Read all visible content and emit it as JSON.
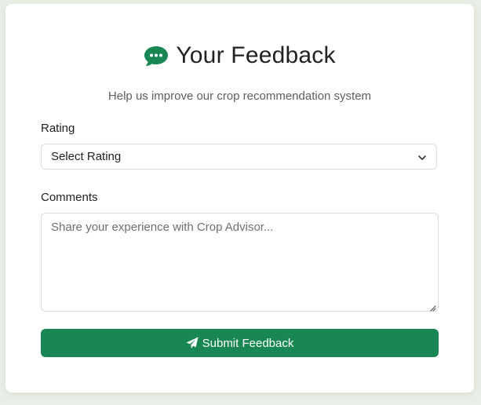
{
  "header": {
    "title": "Your Feedback",
    "subtitle": "Help us improve our crop recommendation system",
    "icon": "chat-bubble-icon"
  },
  "form": {
    "rating_label": "Rating",
    "rating_selected": "Select Rating",
    "comments_label": "Comments",
    "comments_placeholder": "Share your experience with Crop Advisor...",
    "submit_label": "Submit Feedback",
    "submit_icon": "paper-plane-icon"
  },
  "colors": {
    "accent": "#198754",
    "background": "#e9efe6"
  }
}
